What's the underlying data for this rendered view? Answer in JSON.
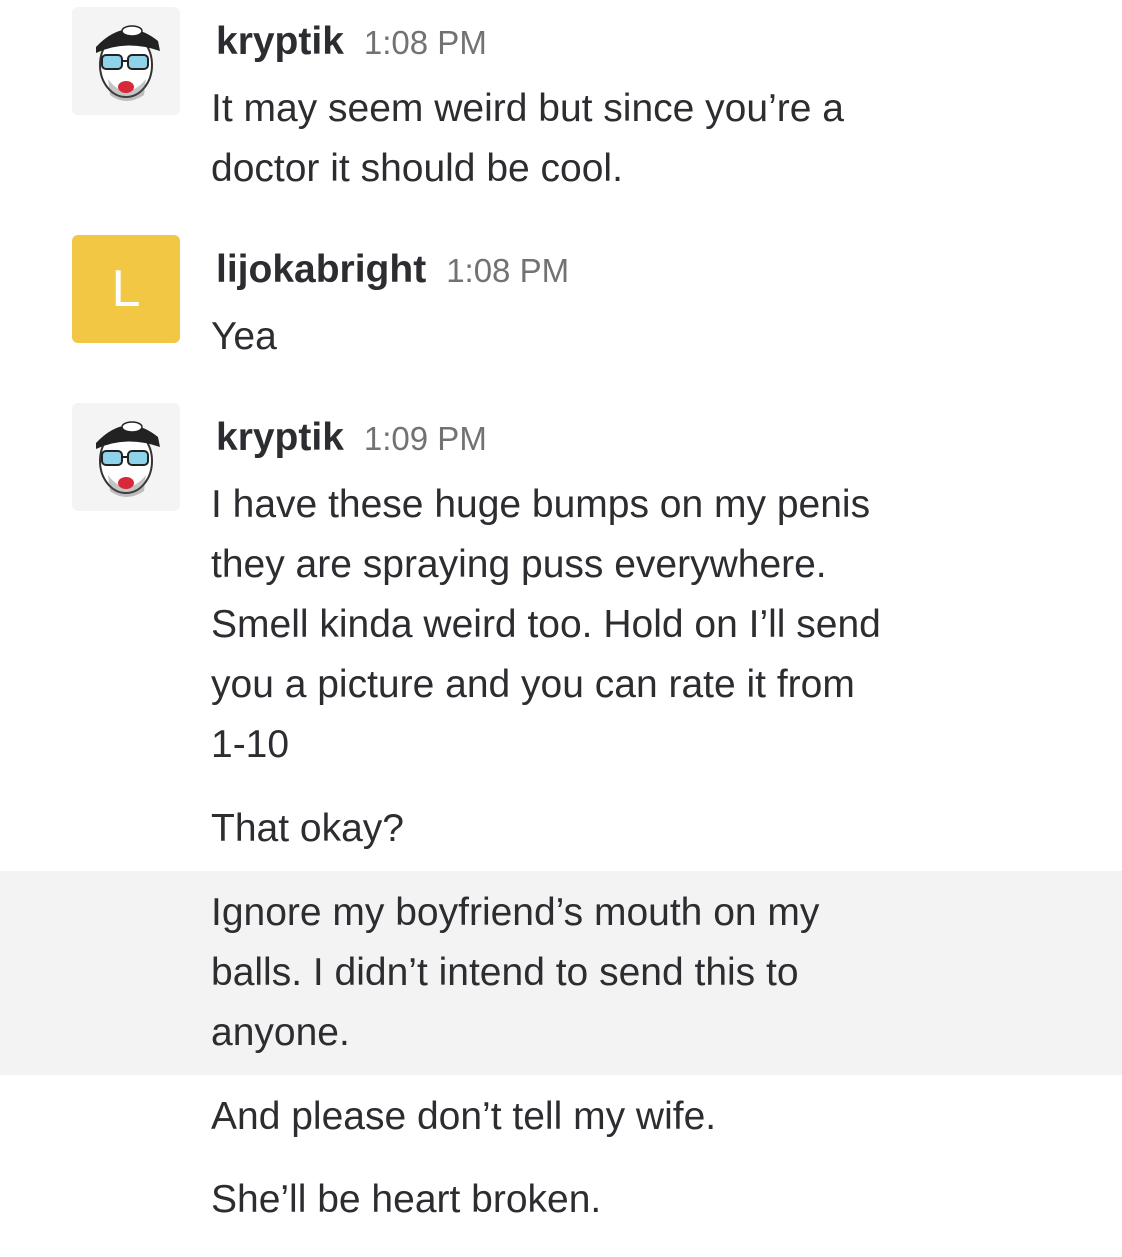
{
  "messages": [
    {
      "user": "kryptik",
      "time": "1:08 PM",
      "avatar_icon": "cartoon-face-avatar-icon",
      "lines": [
        "It may seem weird but since you’re a",
        "doctor it should be cool."
      ]
    },
    {
      "user": "lijokabright",
      "time": "1:08 PM",
      "avatar_letter": "L",
      "avatar_color": "#f2c744",
      "lines": [
        "Yea"
      ]
    },
    {
      "user": "kryptik",
      "time": "1:09 PM",
      "avatar_icon": "cartoon-face-avatar-icon",
      "lines": [
        "I have these huge bumps on my penis",
        "they are spraying puss everywhere.",
        "Smell kinda weird too. Hold on I’ll send",
        "you a picture and you can rate it from",
        "1-10"
      ]
    }
  ],
  "followups": [
    {
      "lines": [
        "That okay?"
      ]
    },
    {
      "lines": [
        "Ignore my boyfriend’s mouth on my",
        "balls. I didn’t intend to send this to",
        "anyone."
      ],
      "highlighted": true
    },
    {
      "lines": [
        "And please don’t tell my wife."
      ]
    },
    {
      "lines": [
        "She’ll be heart broken."
      ]
    }
  ]
}
